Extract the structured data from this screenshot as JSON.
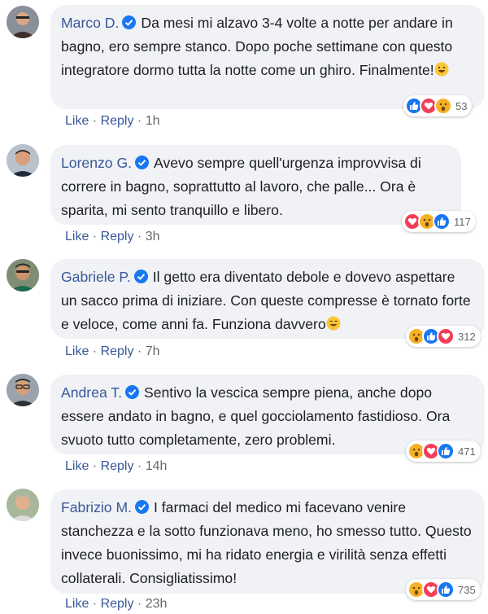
{
  "comments": [
    {
      "name": "Marco D.",
      "text": "Da mesi mi alzavo 3-4 volte a notte per andare in bagno, ero sempre stanco. Dopo poche settimane con questo integratore dormo tutta la notte come un ghiro. Finalmente!",
      "reactions": [
        "like",
        "love",
        "wow"
      ],
      "count": "53",
      "like": "Like",
      "reply": "Reply",
      "time": "1h"
    },
    {
      "name": "Lorenzo G.",
      "text": "Avevo sempre quell'urgenza improvvisa di correre in bagno, soprattutto al lavoro, che palle... Ora è sparita, mi sento tranquillo e libero.",
      "reactions": [
        "love",
        "wow",
        "like"
      ],
      "count": "117",
      "like": "Like",
      "reply": "Reply",
      "time": "3h"
    },
    {
      "name": "Gabriele P.",
      "text": "Il getto era diventato debole e dovevo aspettare un sacco prima di iniziare. Con queste compresse è tornato forte e veloce, come anni fa. Funziona davvero",
      "reactions": [
        "wow",
        "like",
        "love"
      ],
      "count": "312",
      "like": "Like",
      "reply": "Reply",
      "time": "7h"
    },
    {
      "name": "Andrea T.",
      "text": "Sentivo la vescica sempre piena, anche dopo essere andato in bagno, e quel gocciolamento fastidioso. Ora svuoto tutto completamente, zero problemi.",
      "reactions": [
        "wow",
        "love",
        "like"
      ],
      "count": "471",
      "like": "Like",
      "reply": "Reply",
      "time": "14h"
    },
    {
      "name": "Fabrizio M.",
      "text": "I farmaci del medico mi facevano venire stanchezza e la sotto funzionava meno, ho smesso tutto. Questo invece buonissimo, mi ha ridato energia e virilità senza effetti collaterali. Consigliatissimo!",
      "reactions": [
        "wow",
        "love",
        "like"
      ],
      "count": "735",
      "like": "Like",
      "reply": "Reply",
      "time": "23h"
    }
  ],
  "colors": {
    "bubble": "#f0f2f5",
    "name": "#385898",
    "like_blue": "#1877f2",
    "love_red": "#f33e58",
    "wow_yellow": "#f7b125"
  }
}
